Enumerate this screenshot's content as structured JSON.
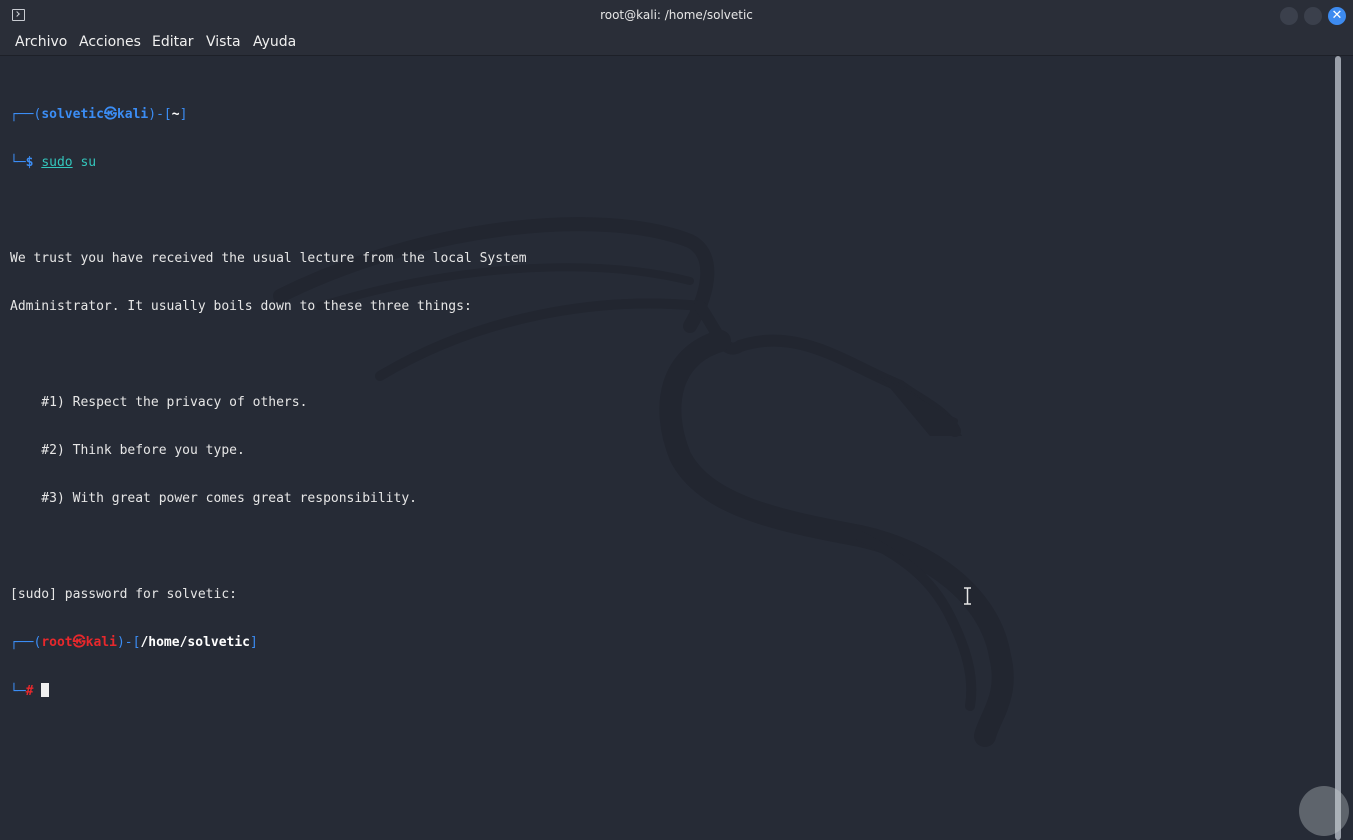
{
  "window": {
    "title": "root@kali: /home/solvetic",
    "close_glyph": "✕"
  },
  "menu": {
    "items": [
      "Archivo",
      "Acciones",
      "Editar",
      "Vista",
      "Ayuda"
    ]
  },
  "prompt1": {
    "corner_top": "┌──",
    "open": "(",
    "user": "solvetic",
    "at": "㉿",
    "host": "kali",
    "close": ")",
    "dash": "-",
    "bracket_open": "[",
    "path": "~",
    "bracket_close": "]",
    "corner_bottom": "└─",
    "symbol": "$",
    "cmd": "sudo",
    "arg": "su"
  },
  "lecture": {
    "line1": "We trust you have received the usual lecture from the local System",
    "line2": "Administrator. It usually boils down to these three things:",
    "rule1": "    #1) Respect the privacy of others.",
    "rule2": "    #2) Think before you type.",
    "rule3": "    #3) With great power comes great responsibility."
  },
  "password_prompt": "[sudo] password for solvetic:",
  "prompt2": {
    "corner_top": "┌──",
    "open": "(",
    "user": "root",
    "at": "㉿",
    "host": "kali",
    "close": ")",
    "dash": "-",
    "bracket_open": "[",
    "path": "/home/solvetic",
    "bracket_close": "]",
    "corner_bottom": "└─",
    "symbol": "#"
  },
  "colors": {
    "background": "#262b36",
    "prompt_blue": "#3b8df5",
    "root_red": "#e8282c",
    "command_teal": "#33c7bd",
    "close_button": "#3d8bf0"
  },
  "icons": [
    "terminal-app-icon",
    "minimize-icon",
    "maximize-icon",
    "close-icon",
    "kali-dragon-icon",
    "text-cursor-icon"
  ]
}
